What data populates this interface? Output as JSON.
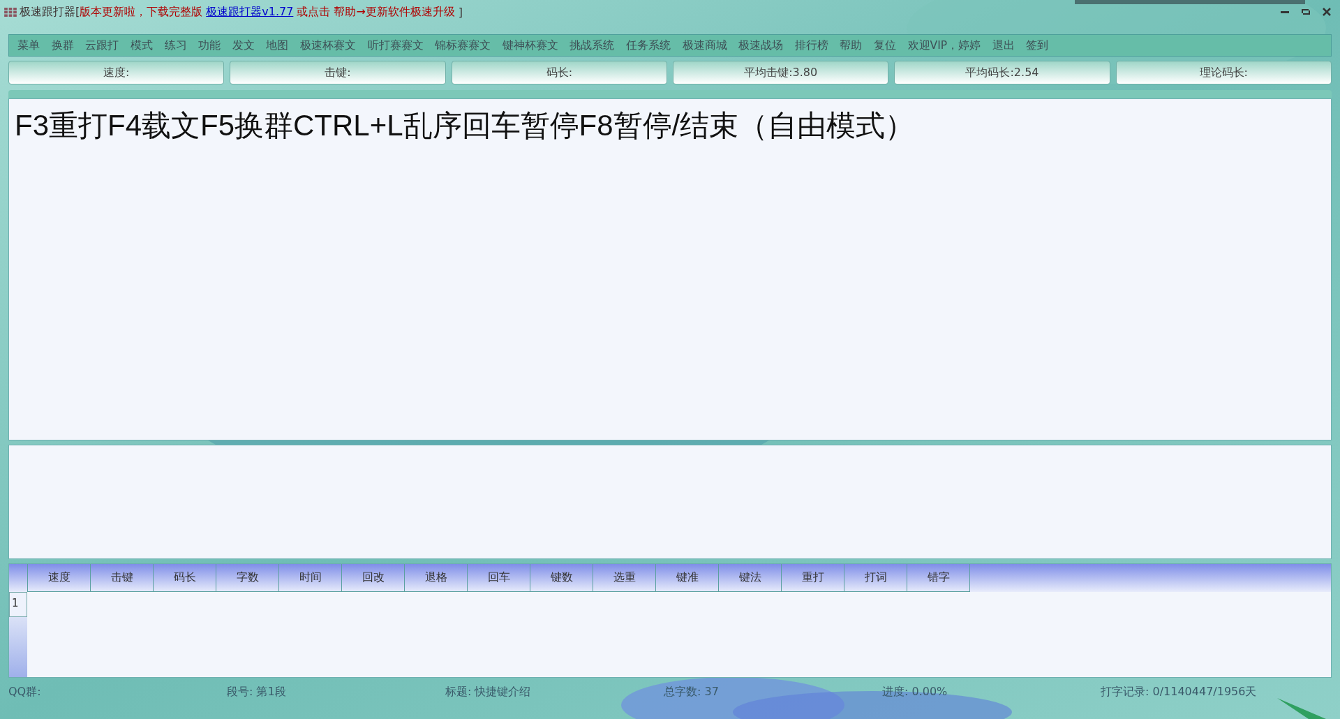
{
  "title": {
    "app": "极速跟打器[",
    "notice": "版本更新啦，下载完整版",
    "link": "极速跟打器v1.77",
    "notice_after": "或点击 帮助→更新软件极速升级",
    "end": "]"
  },
  "menu": [
    "菜单",
    "换群",
    "云跟打",
    "模式",
    "练习",
    "功能",
    "发文",
    "地图",
    "极速杯赛文",
    "听打赛赛文",
    "锦标赛赛文",
    "键神杯赛文",
    "挑战系统",
    "任务系统",
    "极速商城",
    "极速战场",
    "排行榜",
    "帮助",
    "复位",
    "欢迎VIP，婷婷",
    "退出",
    "签到"
  ],
  "stats": [
    "速度:",
    "击键:",
    "码长:",
    "平均击键:3.80",
    "平均码长:2.54",
    "理论码长:"
  ],
  "article": {
    "text": "F3重打F4载文F5换群CTRL+L乱序回车暂停F8暂停/结束（自由模式）"
  },
  "table": {
    "columns": [
      "速度",
      "击键",
      "码长",
      "字数",
      "时间",
      "回改",
      "退格",
      "回车",
      "键数",
      "选重",
      "键准",
      "键法",
      "重打",
      "打词",
      "错字"
    ],
    "rows": [
      {
        "number": "1"
      }
    ]
  },
  "status_bar": [
    "QQ群:",
    "段号: 第1段",
    "标题: 快捷键介绍",
    "总字数: 37",
    "进度: 0.00%",
    "打字记录: 0/1140447/1956天"
  ]
}
